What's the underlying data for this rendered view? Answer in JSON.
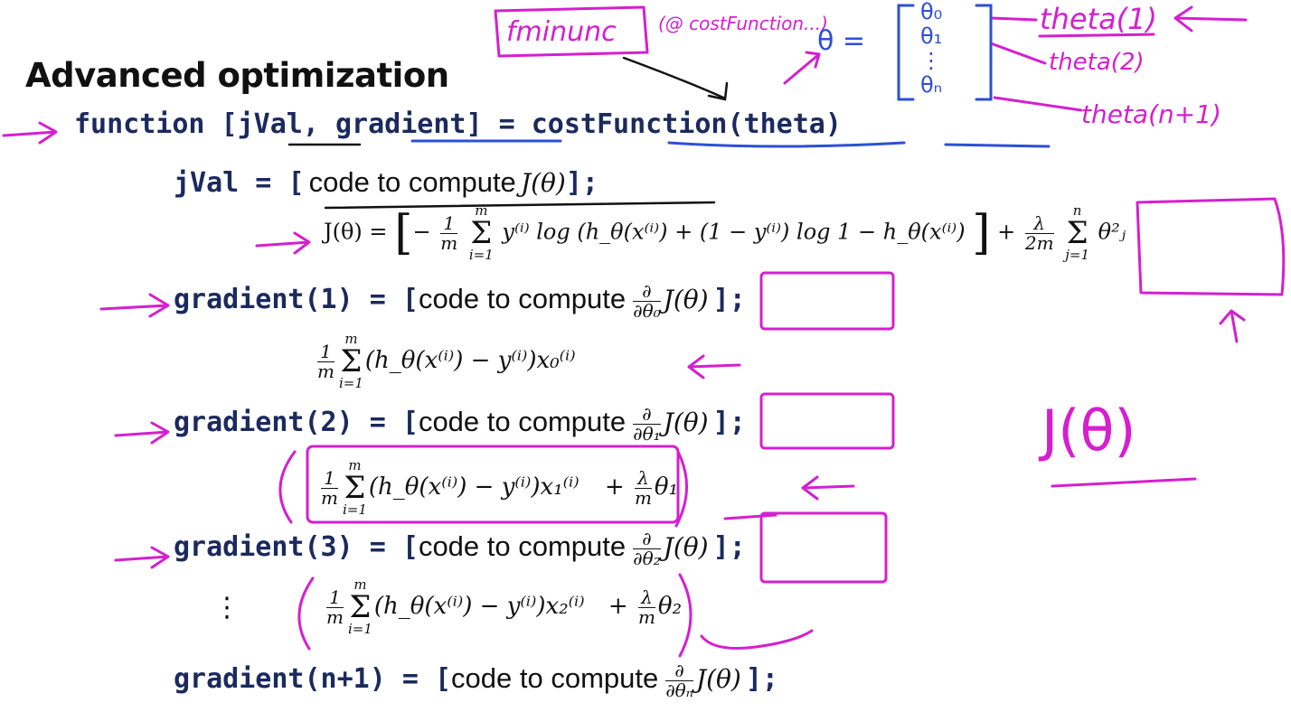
{
  "slide": {
    "title": "Advanced optimization",
    "function_line": "function [jVal, gradient] = costFunction(theta)",
    "jval": {
      "code": "jVal = ",
      "bracket_open": "[",
      "text": "code to compute",
      "math": "J(θ)",
      "bracket_close": "];"
    },
    "cost_formula": {
      "lhs": "J(θ) =",
      "minus": "−",
      "frac_num": "1",
      "frac_den": "m",
      "sum_top": "m",
      "sum_bottom": "i=1",
      "body": "y⁽ⁱ⁾ log (h_θ(x⁽ⁱ⁾) + (1 − y⁽ⁱ⁾) log 1 − h_θ(x⁽ⁱ⁾)",
      "plus": "+",
      "reg_num": "λ",
      "reg_den": "2m",
      "reg_sum_top": "n",
      "reg_sum_bottom": "j=1",
      "reg_body": "θ²ⱼ"
    },
    "gradients": [
      {
        "code": "gradient(1) = ",
        "text": "code to compute",
        "deriv_num": "∂",
        "deriv_den": "∂θ₀",
        "math": "J(θ)",
        "close": "];",
        "formula": "(h_θ(x⁽ⁱ⁾) − y⁽ⁱ⁾)x₀⁽ⁱ⁾",
        "reg": ""
      },
      {
        "code": "gradient(2) = ",
        "text": "code to compute",
        "deriv_num": "∂",
        "deriv_den": "∂θ₁",
        "math": "J(θ)",
        "close": "];",
        "formula": "(h_θ(x⁽ⁱ⁾) − y⁽ⁱ⁾)x₁⁽ⁱ⁾",
        "reg": "θ₁"
      },
      {
        "code": "gradient(3) = ",
        "text": "code to compute",
        "deriv_num": "∂",
        "deriv_den": "∂θ₂",
        "math": "J(θ)",
        "close": "];",
        "formula": "(h_θ(x⁽ⁱ⁾) − y⁽ⁱ⁾)x₂⁽ⁱ⁾",
        "reg": "θ₂"
      },
      {
        "code": "gradient(n+1) = ",
        "text": "code to compute",
        "deriv_num": "∂",
        "deriv_den": "∂θₙ",
        "math": "J(θ)",
        "close": "];"
      }
    ],
    "sum_parts": {
      "num": "1",
      "den": "m",
      "top": "m",
      "bottom": "i=1",
      "lambda": "λ",
      "plus": "+"
    },
    "vertical_dots": "⋮"
  },
  "annotations": {
    "fminunc": "fminunc",
    "fminunc_arg": "(@ costFunction...)",
    "theta_symbol": "θ =",
    "theta_vector": [
      "θ₀",
      "θ₁",
      "⋮",
      "θₙ"
    ],
    "theta_labels": [
      "theta(1)",
      "theta(2)",
      "theta(n+1)"
    ],
    "j_theta": "J(θ)",
    "ink_color": "#d51fd0",
    "vector_color": "#2d4fd6"
  }
}
